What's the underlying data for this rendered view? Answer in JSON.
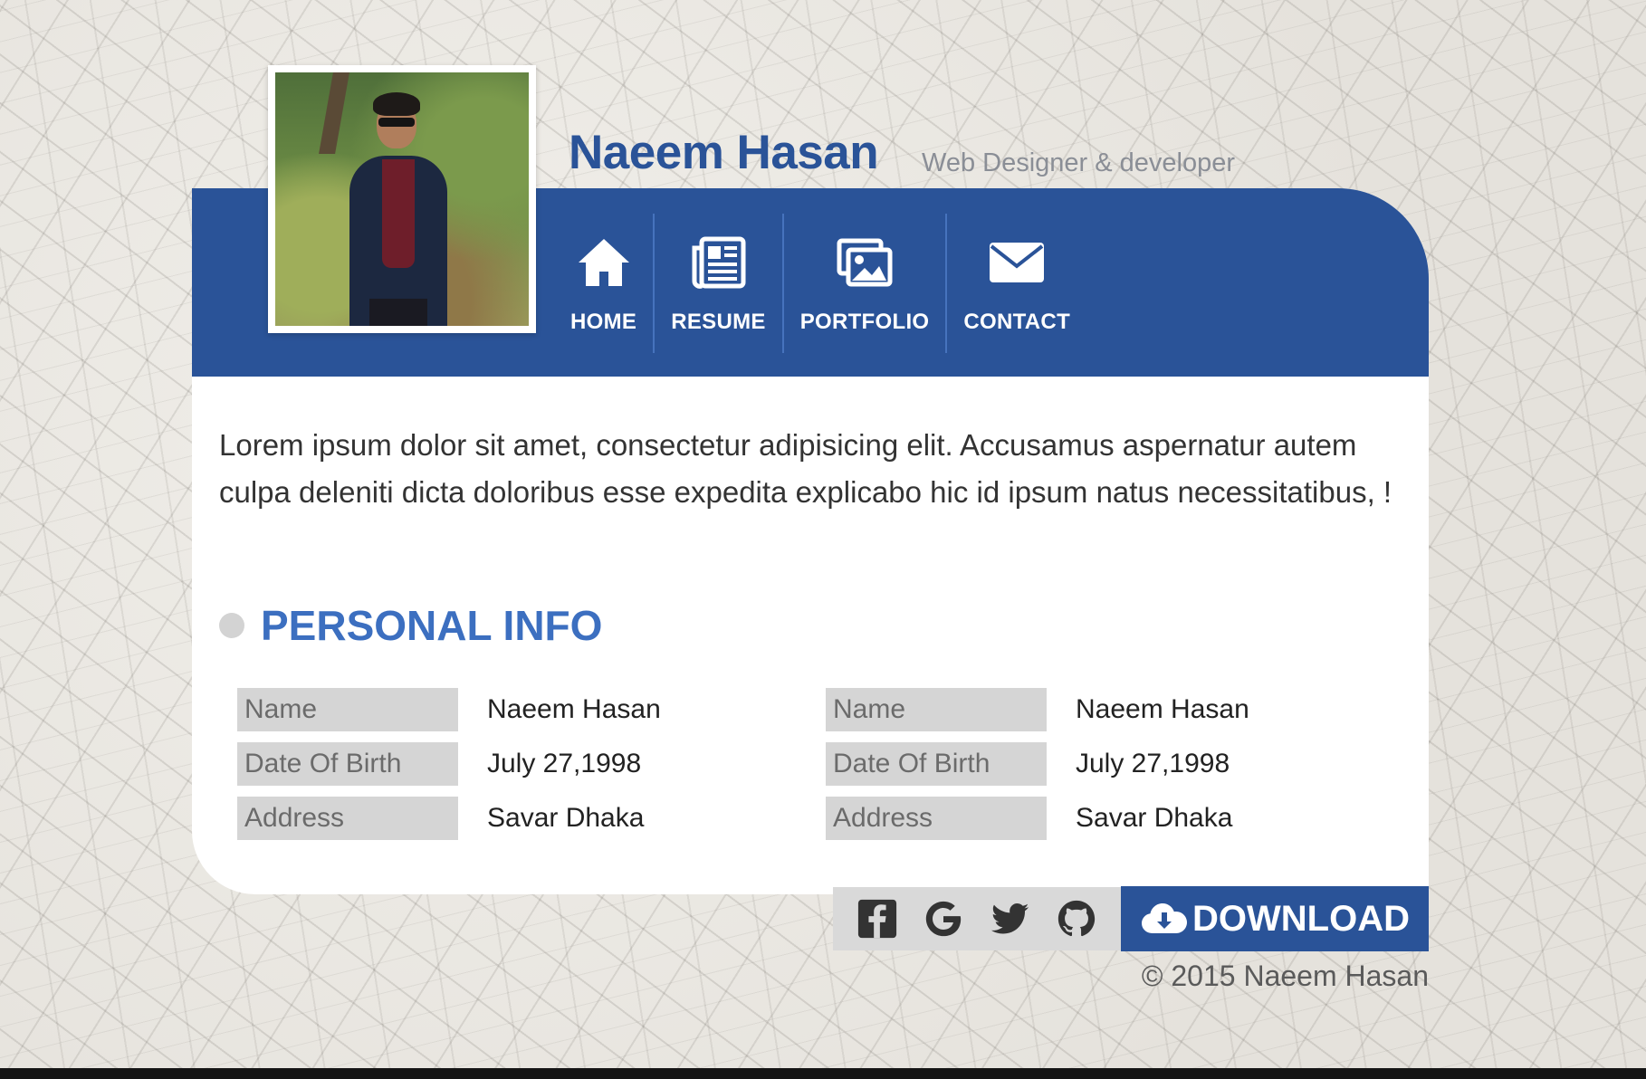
{
  "header": {
    "name": "Naeem Hasan",
    "tagline": "Web Designer & developer"
  },
  "nav": [
    {
      "label": "HOME",
      "icon": "home-icon"
    },
    {
      "label": "RESUME",
      "icon": "newspaper-icon"
    },
    {
      "label": "PORTFOLIO",
      "icon": "images-icon"
    },
    {
      "label": "CONTACT",
      "icon": "envelope-icon"
    }
  ],
  "intro": "Lorem ipsum dolor sit amet, consectetur adipisicing elit. Accusamus aspernatur autem culpa deleniti dicta doloribus esse expedita explicabo hic id ipsum natus necessitatibus, !",
  "personal_info": {
    "title": "PERSONAL INFO",
    "left": [
      {
        "label": "Name",
        "value": "Naeem Hasan"
      },
      {
        "label": "Date Of Birth",
        "value": "July 27,1998"
      },
      {
        "label": "Address",
        "value": "Savar Dhaka"
      }
    ],
    "right": [
      {
        "label": "Name",
        "value": "Naeem Hasan"
      },
      {
        "label": "Date Of Birth",
        "value": "July 27,1998"
      },
      {
        "label": "Address",
        "value": "Savar Dhaka"
      }
    ]
  },
  "social": [
    "facebook-icon",
    "google-icon",
    "twitter-icon",
    "github-icon"
  ],
  "download": {
    "label": "DOWNLOAD",
    "icon": "cloud-download-icon"
  },
  "footer": "© 2015 Naeem Hasan",
  "colors": {
    "brand": "#2a5398",
    "heading": "#3c6fc0",
    "label_bg": "#d5d5d5"
  }
}
